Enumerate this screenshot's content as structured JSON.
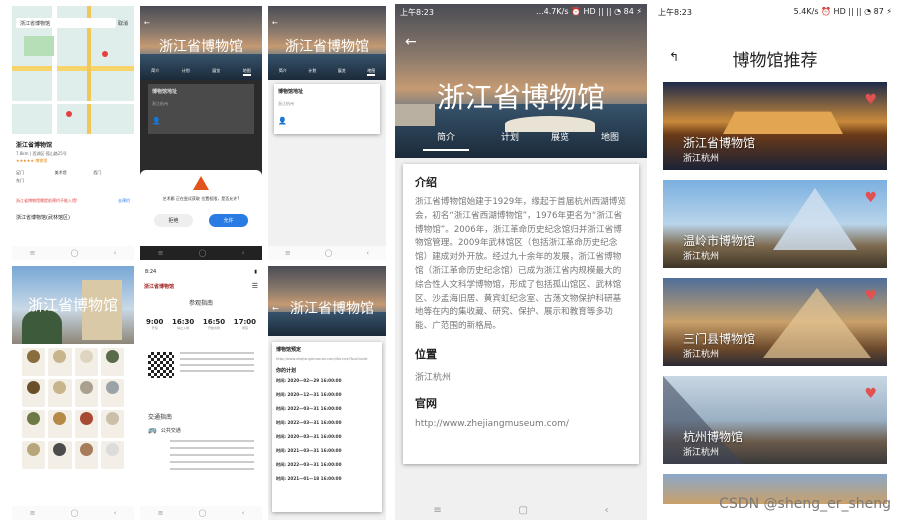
{
  "thumb_map": {
    "search": "浙江省博物馆",
    "cancel": "取消",
    "place_name": "浙江省博物馆",
    "address": "7.8km | 西湖区·孤山路25号",
    "rating": "★★★★★ 博物馆",
    "btns": [
      "足门",
      "美术馆",
      "西门",
      "东门"
    ],
    "tip": "浙江省博物馆需提前预约不能入馆!",
    "tip_action": "去预约",
    "bottom": "浙江省博物馆(武林馆区)"
  },
  "thumb_intro": {
    "title": "浙江省博物馆",
    "tabs": [
      "简介",
      "计划",
      "展览",
      "地图"
    ],
    "section": "博物馆地址",
    "addr": "浙江杭州"
  },
  "thumb_dialog": {
    "title": "浙江省博物馆",
    "msg": "艺术廊 正在尝试获取 位置权限，是否允许?",
    "deny": "拒绝",
    "allow": "允许"
  },
  "thumb_intro2": {
    "title": "浙江省博物馆",
    "tabs": [
      "简介",
      "计划",
      "展览",
      "地图"
    ],
    "section": "博物馆地址",
    "addr": "浙江杭州"
  },
  "thumb_vienna": {
    "title": "浙江省博物馆"
  },
  "thumb_hours": {
    "brand": "浙江省博物馆",
    "head": "参观指南",
    "times": [
      "9:00",
      "16:30",
      "16:50",
      "17:00"
    ],
    "time_caps": [
      "开馆",
      "停止入场",
      "开始清场",
      "闭馆"
    ],
    "traffic": "交通指南",
    "bus": "公共交通"
  },
  "thumb_plan": {
    "title": "浙江省博物馆",
    "section": "博物馆预定",
    "url": "http://www.zhejiangmuseum.com/Service/TourGuide",
    "plan_title": "你的计划",
    "plans": [
      "时间: 2020—02—29 16:00:00",
      "时间: 2020—12—31 16:00:00",
      "时间: 2022—03—31 16:00:00",
      "时间: 2022—03—31 16:00:00",
      "时间: 2020—03—31 16:00:00",
      "时间: 2021—03—31 16:00:00",
      "时间: 2022—03—31 16:00:00",
      "时间: 2021—01—18 16:00:00"
    ]
  },
  "detail": {
    "status_time": "上午8:23",
    "status_right": "...4.7K/s ⏰ HD ||  ||  ◔ 84 ⚡",
    "title": "浙江省博物馆",
    "tabs": [
      "简介",
      "计划",
      "展览",
      "地图"
    ],
    "intro_h": "介绍",
    "intro_t": "浙江省博物馆始建于1929年，缘起于首届杭州西湖博览会，初名“浙江省西湖博物馆”，1976年更名为“浙江省博物馆”。2006年，浙江革命历史纪念馆归并浙江省博物馆管理。2009年武林馆区（包括浙江革命历史纪念馆）建成对外开放。经过九十余年的发展，浙江省博物馆（浙江革命历史纪念馆）已成为浙江省内规模最大的综合性人文科学博物馆，形成了包括孤山馆区、武林馆区、沙孟海旧居、黄宾虹纪念室、古荡文物保护科研基地等在内的集收藏、研究、保护、展示和教育等多功能、广范围的新格局。",
    "loc_h": "位置",
    "loc_t": "浙江杭州",
    "web_h": "官网",
    "web_t": "http://www.zhejiangmuseum.com/"
  },
  "recommend": {
    "status_time": "上午8:23",
    "status_right": "5.4K/s ⏰ HD ||  ||  ◔ 87 ⚡",
    "title": "博物馆推荐",
    "items": [
      {
        "name": "浙江省博物馆",
        "loc": "浙江杭州"
      },
      {
        "name": "温岭市博物馆",
        "loc": "浙江杭州"
      },
      {
        "name": "三门县博物馆",
        "loc": "浙江杭州"
      },
      {
        "name": "杭州博物馆",
        "loc": "浙江杭州"
      }
    ]
  },
  "watermark": "CSDN @sheng_er_sheng",
  "colors": {
    "accent_blue": "#2a7be4",
    "heart": "#e35050",
    "warn": "#e2541e"
  }
}
